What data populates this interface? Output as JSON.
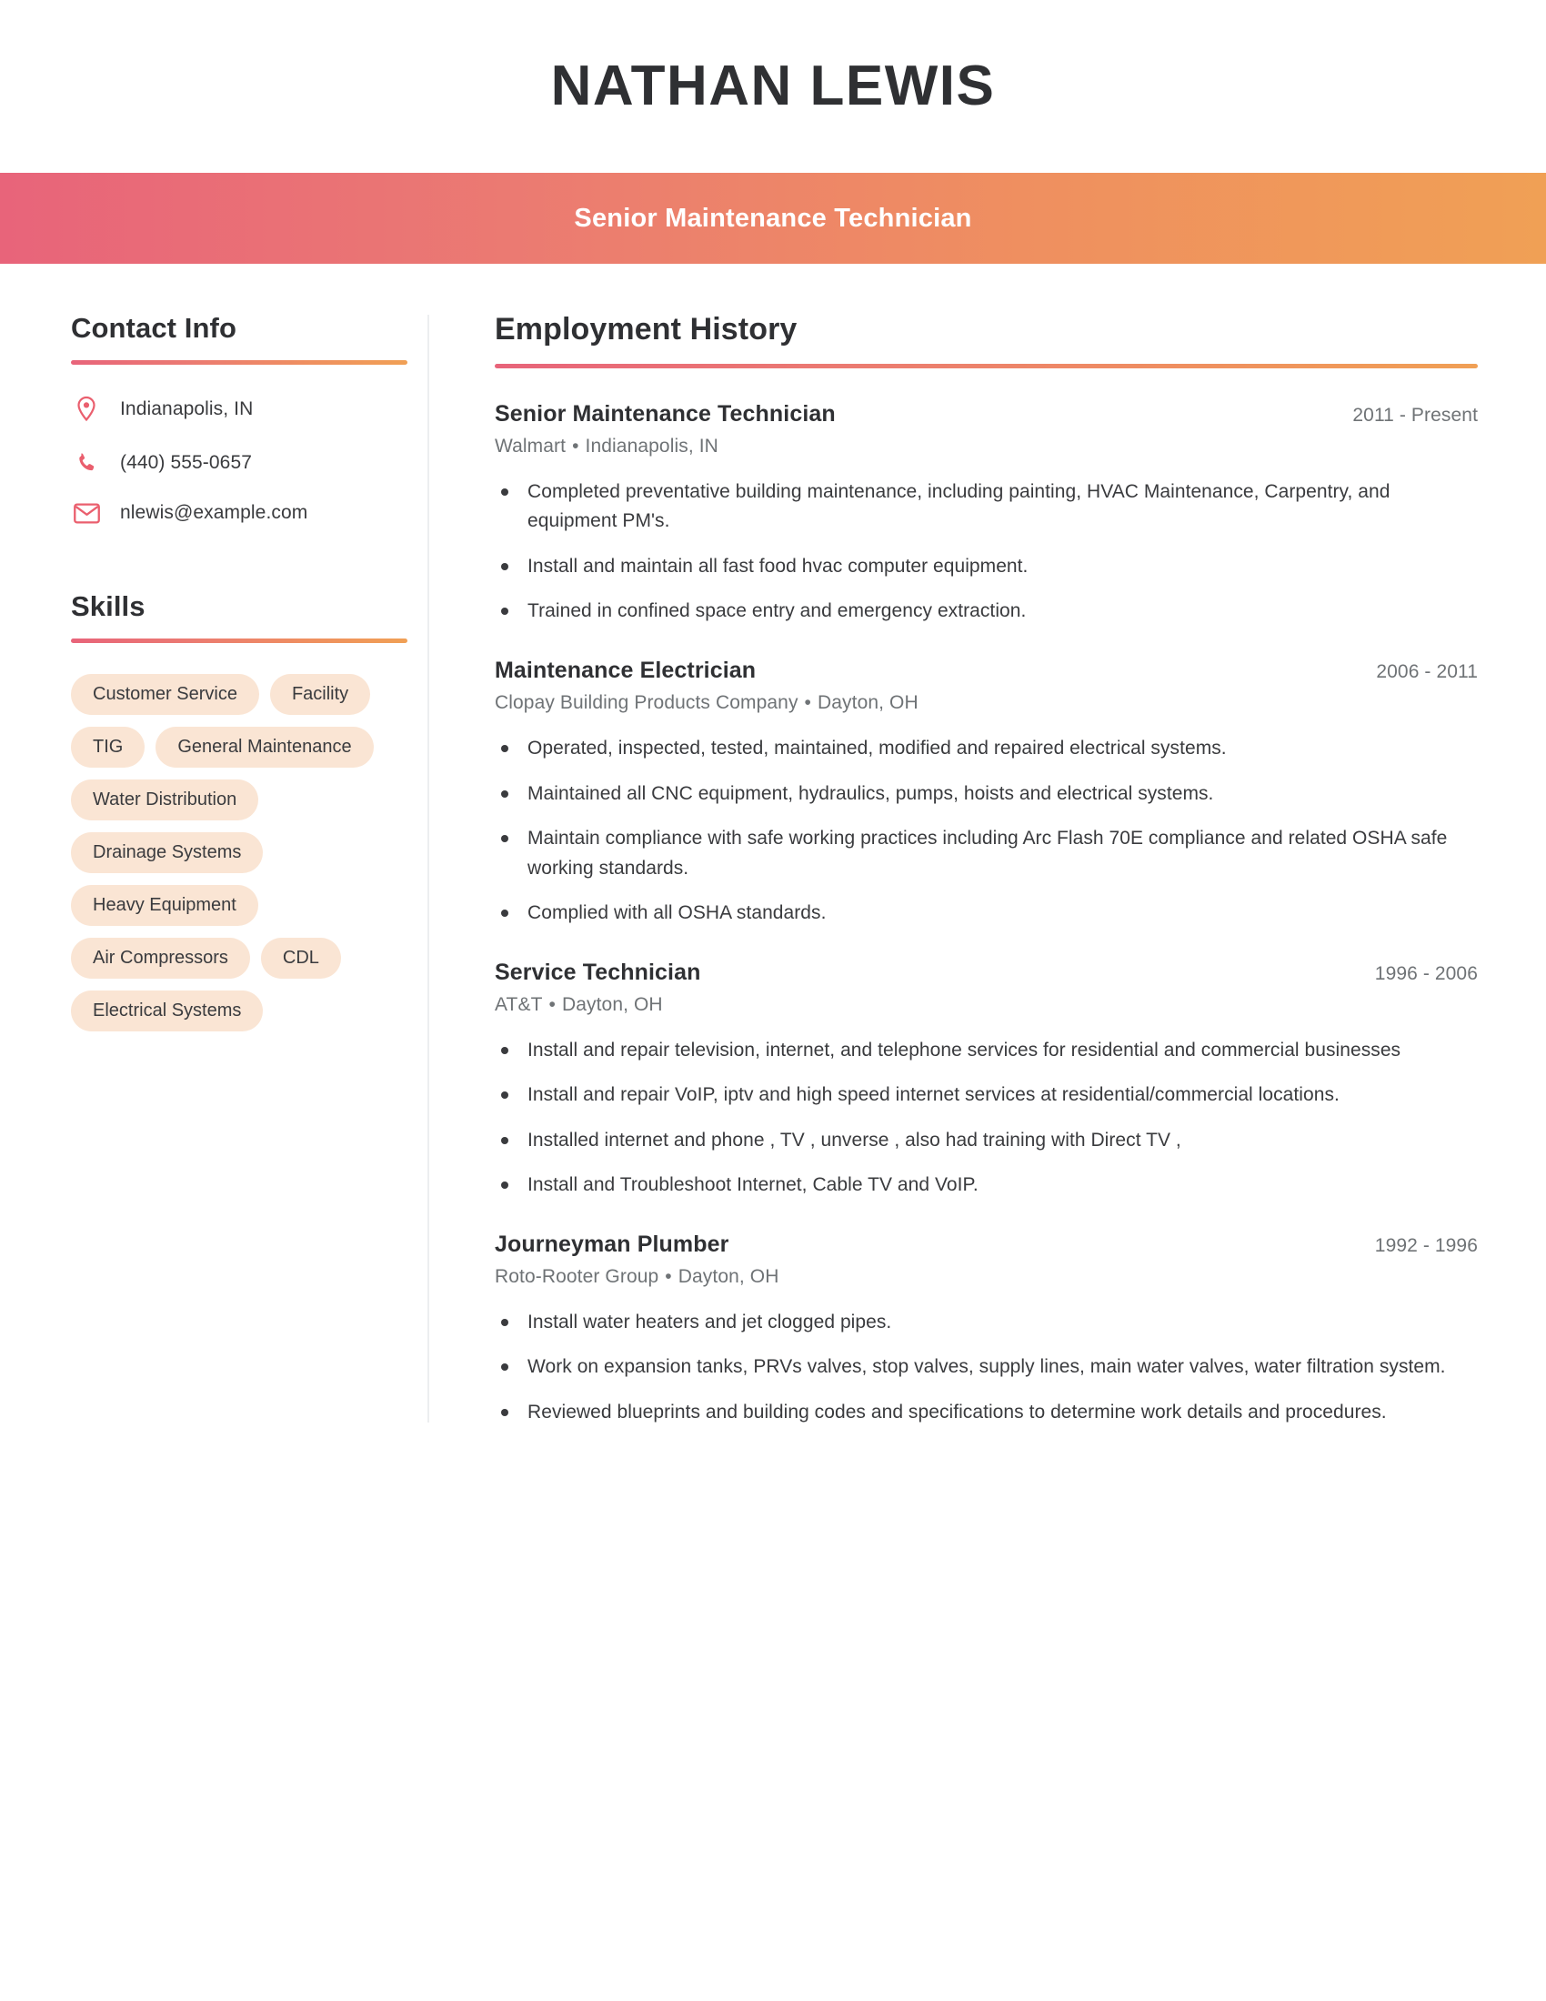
{
  "header": {
    "name": "NATHAN LEWIS",
    "job_title": "Senior Maintenance Technician",
    "gradient_start": "#e8647a",
    "gradient_end": "#f0a055"
  },
  "sidebar": {
    "contact": {
      "heading": "Contact Info",
      "items": [
        {
          "icon": "location-pin-icon",
          "value": "Indianapolis, IN"
        },
        {
          "icon": "phone-icon",
          "value": "(440) 555-0657"
        },
        {
          "icon": "envelope-icon",
          "value": "nlewis@example.com"
        }
      ]
    },
    "skills": {
      "heading": "Skills",
      "tag_color": "#fae5d4",
      "items": [
        "Customer Service",
        "Facility",
        "TIG",
        "General Maintenance",
        "Water Distribution",
        "Drainage Systems",
        "Heavy Equipment",
        "Air Compressors",
        "CDL",
        "Electrical Systems"
      ]
    }
  },
  "main": {
    "heading": "Employment History",
    "jobs": [
      {
        "title": "Senior Maintenance Technician",
        "dates": "2011 - Present",
        "company": "Walmart",
        "location": "Indianapolis, IN",
        "bullets": [
          "Completed preventative building maintenance, including painting, HVAC Maintenance, Carpentry, and equipment PM's.",
          "Install and maintain all fast food hvac computer equipment.",
          "Trained in confined space entry and emergency extraction."
        ]
      },
      {
        "title": "Maintenance Electrician",
        "dates": "2006 - 2011",
        "company": "Clopay Building Products Company",
        "location": "Dayton, OH",
        "bullets": [
          "Operated, inspected, tested, maintained, modified and repaired electrical systems.",
          "Maintained all CNC equipment, hydraulics, pumps, hoists and electrical systems.",
          "Maintain compliance with safe working practices including Arc Flash 70E compliance and related OSHA safe working standards.",
          "Complied with all OSHA standards."
        ]
      },
      {
        "title": "Service Technician",
        "dates": "1996 - 2006",
        "company": "AT&T",
        "location": "Dayton, OH",
        "bullets": [
          "Install and repair television, internet, and telephone services for residential and commercial businesses",
          "Install and repair VoIP, iptv and high speed internet services at residential/commercial locations.",
          "Installed internet and phone , TV , unverse , also had training with Direct TV ,",
          "Install and Troubleshoot Internet, Cable TV and VoIP."
        ]
      },
      {
        "title": "Journeyman Plumber",
        "dates": "1992 - 1996",
        "company": "Roto-Rooter Group",
        "location": "Dayton, OH",
        "bullets": [
          "Install water heaters and jet clogged pipes.",
          "Work on expansion tanks, PRVs valves, stop valves, supply lines, main water valves, water filtration system.",
          "Reviewed blueprints and building codes and specifications to determine work details and procedures."
        ]
      }
    ],
    "separator": "•"
  }
}
